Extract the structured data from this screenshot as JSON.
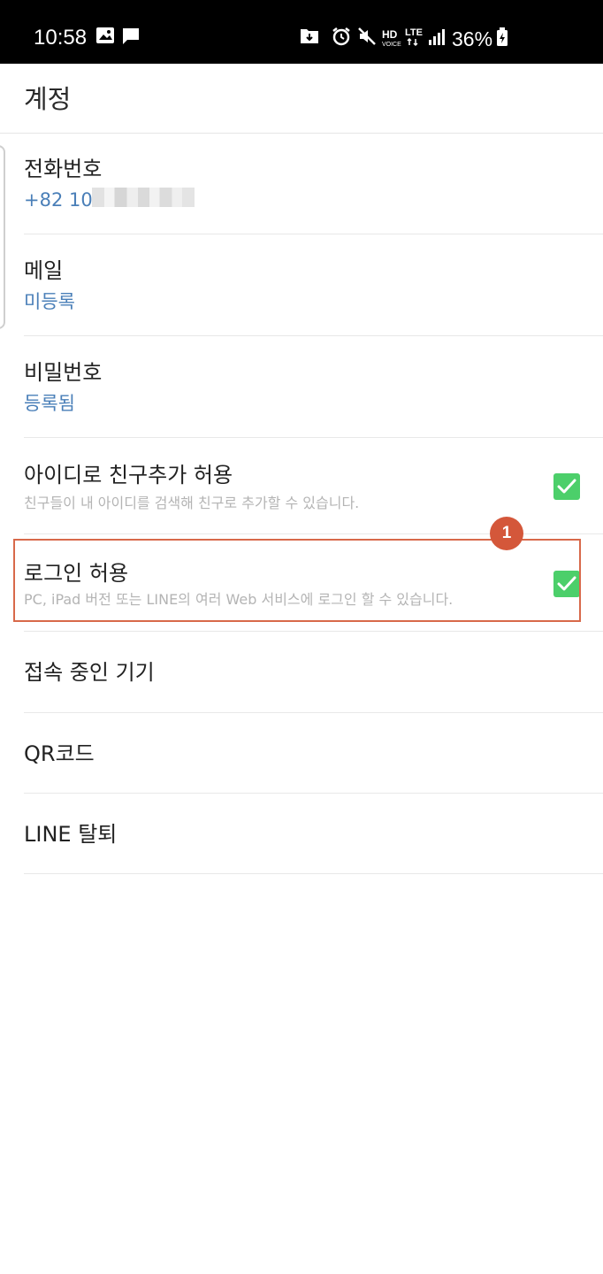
{
  "status_bar": {
    "time": "10:58",
    "battery_percent": "36%",
    "network": "LTE",
    "icons": [
      "image-icon",
      "message-icon",
      "download-icon",
      "alarm-icon",
      "mute-icon",
      "hd-voice-icon",
      "lte-icon",
      "signal-icon",
      "battery-charging-icon"
    ]
  },
  "header": {
    "title": "계정"
  },
  "settings": {
    "phone": {
      "title": "전화번호",
      "value": "+82 10-"
    },
    "email": {
      "title": "메일",
      "value": "미등록"
    },
    "password": {
      "title": "비밀번호",
      "value": "등록됨"
    },
    "allow_add_by_id": {
      "title": "아이디로 친구추가 허용",
      "description": "친구들이 내 아이디를 검색해 친구로 추가할 수 있습니다.",
      "checked": true
    },
    "allow_login": {
      "title": "로그인 허용",
      "description": "PC, iPad 버전 또는 LINE의 여러 Web 서비스에 로그인 할 수 있습니다.",
      "checked": true
    },
    "connected_devices": {
      "title": "접속 중인 기기"
    },
    "qr_code": {
      "title": "QR코드"
    },
    "delete_account": {
      "title": "LINE 탈퇴"
    }
  },
  "annotation": {
    "badge_number": "1"
  },
  "colors": {
    "status_bar_bg": "#000000",
    "value_text": "#4a7fb8",
    "checkbox": "#4ccf6a",
    "highlight": "#d8694a",
    "badge": "#d4573a"
  }
}
